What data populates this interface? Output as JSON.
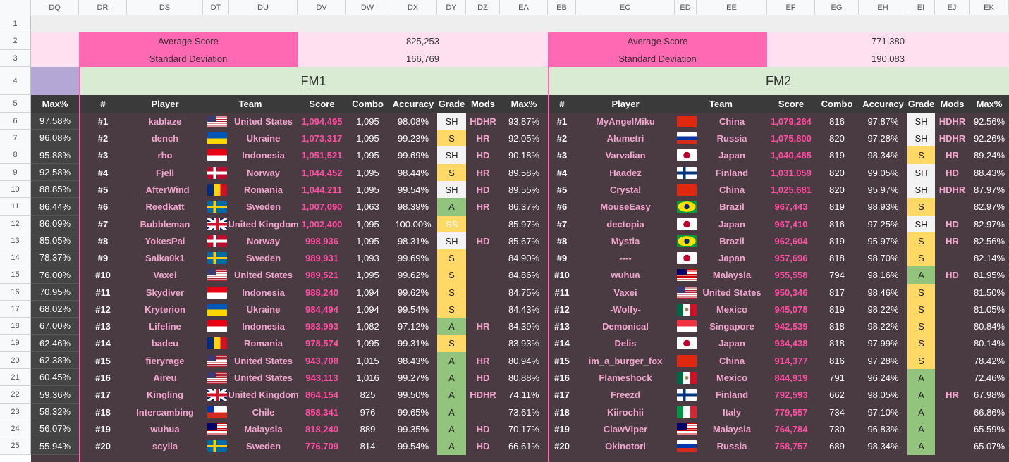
{
  "column_headers": [
    "DQ",
    "DR",
    "DS",
    "DT",
    "DU",
    "DV",
    "DW",
    "DX",
    "DY",
    "DZ",
    "EA",
    "EB",
    "EC",
    "ED",
    "EE",
    "EF",
    "EG",
    "EH",
    "EI",
    "EJ",
    "EK"
  ],
  "row_numbers": [
    "1",
    "2",
    "3",
    "4",
    "5",
    "6",
    "7",
    "8",
    "9",
    "10",
    "11",
    "12",
    "13",
    "14",
    "15",
    "16",
    "17",
    "18",
    "19",
    "20",
    "21",
    "22",
    "23",
    "24",
    "25"
  ],
  "stats_left": {
    "avg_label": "Average Score",
    "avg_value": "825,253",
    "sd_label": "Standard Deviation",
    "sd_value": "166,769"
  },
  "stats_right": {
    "avg_label": "Average Score",
    "avg_value": "771,380",
    "sd_label": "Standard Deviation",
    "sd_value": "190,083"
  },
  "fm1_title": "FM1",
  "fm2_title": "FM2",
  "left_max_header": "Max%",
  "table_headers": {
    "num": "#",
    "player": "Player",
    "team": "Team",
    "score": "Score",
    "combo": "Combo",
    "accuracy": "Accuracy",
    "grade": "Grade",
    "mods": "Mods",
    "max": "Max%"
  },
  "left_max": [
    "97.58%",
    "96.08%",
    "95.88%",
    "92.58%",
    "88.85%",
    "86.44%",
    "86.09%",
    "85.05%",
    "78.37%",
    "76.00%",
    "70.95%",
    "68.02%",
    "67.00%",
    "62.46%",
    "62.38%",
    "60.45%",
    "59.36%",
    "58.32%",
    "56.07%",
    "55.94%"
  ],
  "fm1_rows": [
    {
      "num": "#1",
      "player": "kablaze",
      "flag": "us",
      "team": "United States",
      "score": "1,094,495",
      "combo": "1,095",
      "acc": "98.08%",
      "grade": "SH",
      "mods": "HDHR",
      "max": "93.87%"
    },
    {
      "num": "#2",
      "player": "dench",
      "flag": "ua",
      "team": "Ukraine",
      "score": "1,073,317",
      "combo": "1,095",
      "acc": "99.23%",
      "grade": "S",
      "mods": "HR",
      "max": "92.05%"
    },
    {
      "num": "#3",
      "player": "rho",
      "flag": "id",
      "team": "Indonesia",
      "score": "1,051,521",
      "combo": "1,095",
      "acc": "99.69%",
      "grade": "SH",
      "mods": "HD",
      "max": "90.18%"
    },
    {
      "num": "#4",
      "player": "Fjell",
      "flag": "no",
      "team": "Norway",
      "score": "1,044,452",
      "combo": "1,095",
      "acc": "98.44%",
      "grade": "S",
      "mods": "HR",
      "max": "89.58%"
    },
    {
      "num": "#5",
      "player": "_AfterWind",
      "flag": "ro",
      "team": "Romania",
      "score": "1,044,211",
      "combo": "1,095",
      "acc": "99.54%",
      "grade": "SH",
      "mods": "HD",
      "max": "89.55%"
    },
    {
      "num": "#6",
      "player": "Reedkatt",
      "flag": "se",
      "team": "Sweden",
      "score": "1,007,090",
      "combo": "1,063",
      "acc": "98.39%",
      "grade": "A",
      "mods": "HR",
      "max": "86.37%"
    },
    {
      "num": "#7",
      "player": "Bubbleman",
      "flag": "gb",
      "team": "United Kingdom",
      "score": "1,002,400",
      "combo": "1,095",
      "acc": "100.00%",
      "grade": "SS",
      "mods": "",
      "max": "85.97%"
    },
    {
      "num": "#8",
      "player": "YokesPai",
      "flag": "no",
      "team": "Norway",
      "score": "998,936",
      "combo": "1,095",
      "acc": "98.31%",
      "grade": "SH",
      "mods": "HD",
      "max": "85.67%"
    },
    {
      "num": "#9",
      "player": "Saika0k1",
      "flag": "se",
      "team": "Sweden",
      "score": "989,931",
      "combo": "1,093",
      "acc": "99.69%",
      "grade": "S",
      "mods": "",
      "max": "84.90%"
    },
    {
      "num": "#10",
      "player": "Vaxei",
      "flag": "us",
      "team": "United States",
      "score": "989,521",
      "combo": "1,095",
      "acc": "99.62%",
      "grade": "S",
      "mods": "",
      "max": "84.86%"
    },
    {
      "num": "#11",
      "player": "Skydiver",
      "flag": "id",
      "team": "Indonesia",
      "score": "988,240",
      "combo": "1,094",
      "acc": "99.62%",
      "grade": "S",
      "mods": "",
      "max": "84.75%"
    },
    {
      "num": "#12",
      "player": "Kryterion",
      "flag": "ua",
      "team": "Ukraine",
      "score": "984,494",
      "combo": "1,094",
      "acc": "99.54%",
      "grade": "S",
      "mods": "",
      "max": "84.43%"
    },
    {
      "num": "#13",
      "player": "Lifeline",
      "flag": "id",
      "team": "Indonesia",
      "score": "983,993",
      "combo": "1,082",
      "acc": "97.12%",
      "grade": "A",
      "mods": "HR",
      "max": "84.39%"
    },
    {
      "num": "#14",
      "player": "badeu",
      "flag": "ro",
      "team": "Romania",
      "score": "978,574",
      "combo": "1,095",
      "acc": "99.31%",
      "grade": "S",
      "mods": "",
      "max": "83.93%"
    },
    {
      "num": "#15",
      "player": "fieryrage",
      "flag": "us",
      "team": "United States",
      "score": "943,708",
      "combo": "1,015",
      "acc": "98.43%",
      "grade": "A",
      "mods": "HR",
      "max": "80.94%"
    },
    {
      "num": "#16",
      "player": "Aireu",
      "flag": "us",
      "team": "United States",
      "score": "943,113",
      "combo": "1,016",
      "acc": "99.27%",
      "grade": "A",
      "mods": "HD",
      "max": "80.88%"
    },
    {
      "num": "#17",
      "player": "Kingling",
      "flag": "gb",
      "team": "United Kingdom",
      "score": "864,154",
      "combo": "825",
      "acc": "99.50%",
      "grade": "A",
      "mods": "HDHR",
      "max": "74.11%"
    },
    {
      "num": "#18",
      "player": "Intercambing",
      "flag": "cl",
      "team": "Chile",
      "score": "858,341",
      "combo": "976",
      "acc": "99.65%",
      "grade": "A",
      "mods": "",
      "max": "73.61%"
    },
    {
      "num": "#19",
      "player": "wuhua",
      "flag": "my",
      "team": "Malaysia",
      "score": "818,240",
      "combo": "889",
      "acc": "99.35%",
      "grade": "A",
      "mods": "HD",
      "max": "70.17%"
    },
    {
      "num": "#20",
      "player": "scylla",
      "flag": "se",
      "team": "Sweden",
      "score": "776,709",
      "combo": "814",
      "acc": "99.54%",
      "grade": "A",
      "mods": "HD",
      "max": "66.61%"
    }
  ],
  "fm2_rows": [
    {
      "num": "#1",
      "player": "MyAngelMiku",
      "flag": "cn",
      "team": "China",
      "score": "1,079,264",
      "combo": "816",
      "acc": "97.87%",
      "grade": "SH",
      "mods": "HDHR",
      "max": "92.56%"
    },
    {
      "num": "#2",
      "player": "Alumetri",
      "flag": "ru",
      "team": "Russia",
      "score": "1,075,800",
      "combo": "820",
      "acc": "97.28%",
      "grade": "SH",
      "mods": "HDHR",
      "max": "92.26%"
    },
    {
      "num": "#3",
      "player": "Varvalian",
      "flag": "jp",
      "team": "Japan",
      "score": "1,040,485",
      "combo": "819",
      "acc": "98.34%",
      "grade": "S",
      "mods": "HR",
      "max": "89.24%"
    },
    {
      "num": "#4",
      "player": "Haadez",
      "flag": "fi",
      "team": "Finland",
      "score": "1,031,059",
      "combo": "820",
      "acc": "99.05%",
      "grade": "SH",
      "mods": "HD",
      "max": "88.43%"
    },
    {
      "num": "#5",
      "player": "Crystal",
      "flag": "cn",
      "team": "China",
      "score": "1,025,681",
      "combo": "820",
      "acc": "95.97%",
      "grade": "SH",
      "mods": "HDHR",
      "max": "87.97%"
    },
    {
      "num": "#6",
      "player": "MouseEasy",
      "flag": "br",
      "team": "Brazil",
      "score": "967,443",
      "combo": "819",
      "acc": "98.93%",
      "grade": "S",
      "mods": "",
      "max": "82.97%"
    },
    {
      "num": "#7",
      "player": "dectopia",
      "flag": "jp",
      "team": "Japan",
      "score": "967,410",
      "combo": "816",
      "acc": "97.25%",
      "grade": "SH",
      "mods": "HD",
      "max": "82.97%"
    },
    {
      "num": "#8",
      "player": "Mystia",
      "flag": "br",
      "team": "Brazil",
      "score": "962,604",
      "combo": "819",
      "acc": "95.97%",
      "grade": "S",
      "mods": "HR",
      "max": "82.56%"
    },
    {
      "num": "#9",
      "player": "----",
      "flag": "jp",
      "team": "Japan",
      "score": "957,696",
      "combo": "818",
      "acc": "98.70%",
      "grade": "S",
      "mods": "",
      "max": "82.14%"
    },
    {
      "num": "#10",
      "player": "wuhua",
      "flag": "my",
      "team": "Malaysia",
      "score": "955,558",
      "combo": "794",
      "acc": "98.16%",
      "grade": "A",
      "mods": "HD",
      "max": "81.95%"
    },
    {
      "num": "#11",
      "player": "Vaxei",
      "flag": "us",
      "team": "United States",
      "score": "950,346",
      "combo": "817",
      "acc": "98.46%",
      "grade": "S",
      "mods": "",
      "max": "81.50%"
    },
    {
      "num": "#12",
      "player": "-Wolfy-",
      "flag": "mx",
      "team": "Mexico",
      "score": "945,078",
      "combo": "819",
      "acc": "98.22%",
      "grade": "S",
      "mods": "",
      "max": "81.05%"
    },
    {
      "num": "#13",
      "player": "Demonical",
      "flag": "sg",
      "team": "Singapore",
      "score": "942,539",
      "combo": "818",
      "acc": "98.22%",
      "grade": "S",
      "mods": "",
      "max": "80.84%"
    },
    {
      "num": "#14",
      "player": "Delis",
      "flag": "jp",
      "team": "Japan",
      "score": "934,438",
      "combo": "818",
      "acc": "97.99%",
      "grade": "S",
      "mods": "",
      "max": "80.14%"
    },
    {
      "num": "#15",
      "player": "im_a_burger_fox",
      "flag": "cn",
      "team": "China",
      "score": "914,377",
      "combo": "816",
      "acc": "97.28%",
      "grade": "S",
      "mods": "",
      "max": "78.42%"
    },
    {
      "num": "#16",
      "player": "Flameshock",
      "flag": "mx",
      "team": "Mexico",
      "score": "844,919",
      "combo": "791",
      "acc": "96.24%",
      "grade": "A",
      "mods": "",
      "max": "72.46%"
    },
    {
      "num": "#17",
      "player": "Freezd",
      "flag": "fi",
      "team": "Finland",
      "score": "792,593",
      "combo": "662",
      "acc": "98.05%",
      "grade": "A",
      "mods": "HR",
      "max": "67.98%"
    },
    {
      "num": "#18",
      "player": "Kiirochii",
      "flag": "it",
      "team": "Italy",
      "score": "779,557",
      "combo": "734",
      "acc": "97.10%",
      "grade": "A",
      "mods": "",
      "max": "66.86%"
    },
    {
      "num": "#19",
      "player": "ClawViper",
      "flag": "my",
      "team": "Malaysia",
      "score": "764,784",
      "combo": "730",
      "acc": "96.83%",
      "grade": "A",
      "mods": "",
      "max": "65.59%"
    },
    {
      "num": "#20",
      "player": "Okinotori",
      "flag": "ru",
      "team": "Russia",
      "score": "758,757",
      "combo": "689",
      "acc": "98.34%",
      "grade": "A",
      "mods": "",
      "max": "65.07%"
    }
  ],
  "colors": {
    "pink_accent": "#ff69b4",
    "pink_light": "#ffe0f0",
    "title_green": "#d9ecd3",
    "table_bg": "#4a3a42",
    "grade_S": "#ffd966",
    "grade_SH": "#f3f3f3",
    "grade_A": "#93c47d",
    "score_pink": "#ff4fa3",
    "lavender": "#b4a7d6"
  }
}
